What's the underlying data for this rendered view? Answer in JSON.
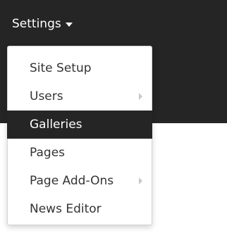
{
  "navbar": {
    "settings_label": "Settings"
  },
  "menu": {
    "items": [
      {
        "label": "Site Setup",
        "has_submenu": false,
        "active": false
      },
      {
        "label": "Users",
        "has_submenu": true,
        "active": false
      },
      {
        "label": "Galleries",
        "has_submenu": false,
        "active": true
      },
      {
        "label": "Pages",
        "has_submenu": false,
        "active": false
      },
      {
        "label": "Page Add-Ons",
        "has_submenu": true,
        "active": false
      },
      {
        "label": "News Editor",
        "has_submenu": false,
        "active": false
      }
    ]
  },
  "colors": {
    "navbar_bg": "#252525",
    "active_bg": "#252525",
    "text": "#333333",
    "arrow": "#c8c8c8"
  },
  "icons": {
    "settings_caret": "caret-down-icon",
    "submenu_arrow": "chevron-right-icon"
  }
}
